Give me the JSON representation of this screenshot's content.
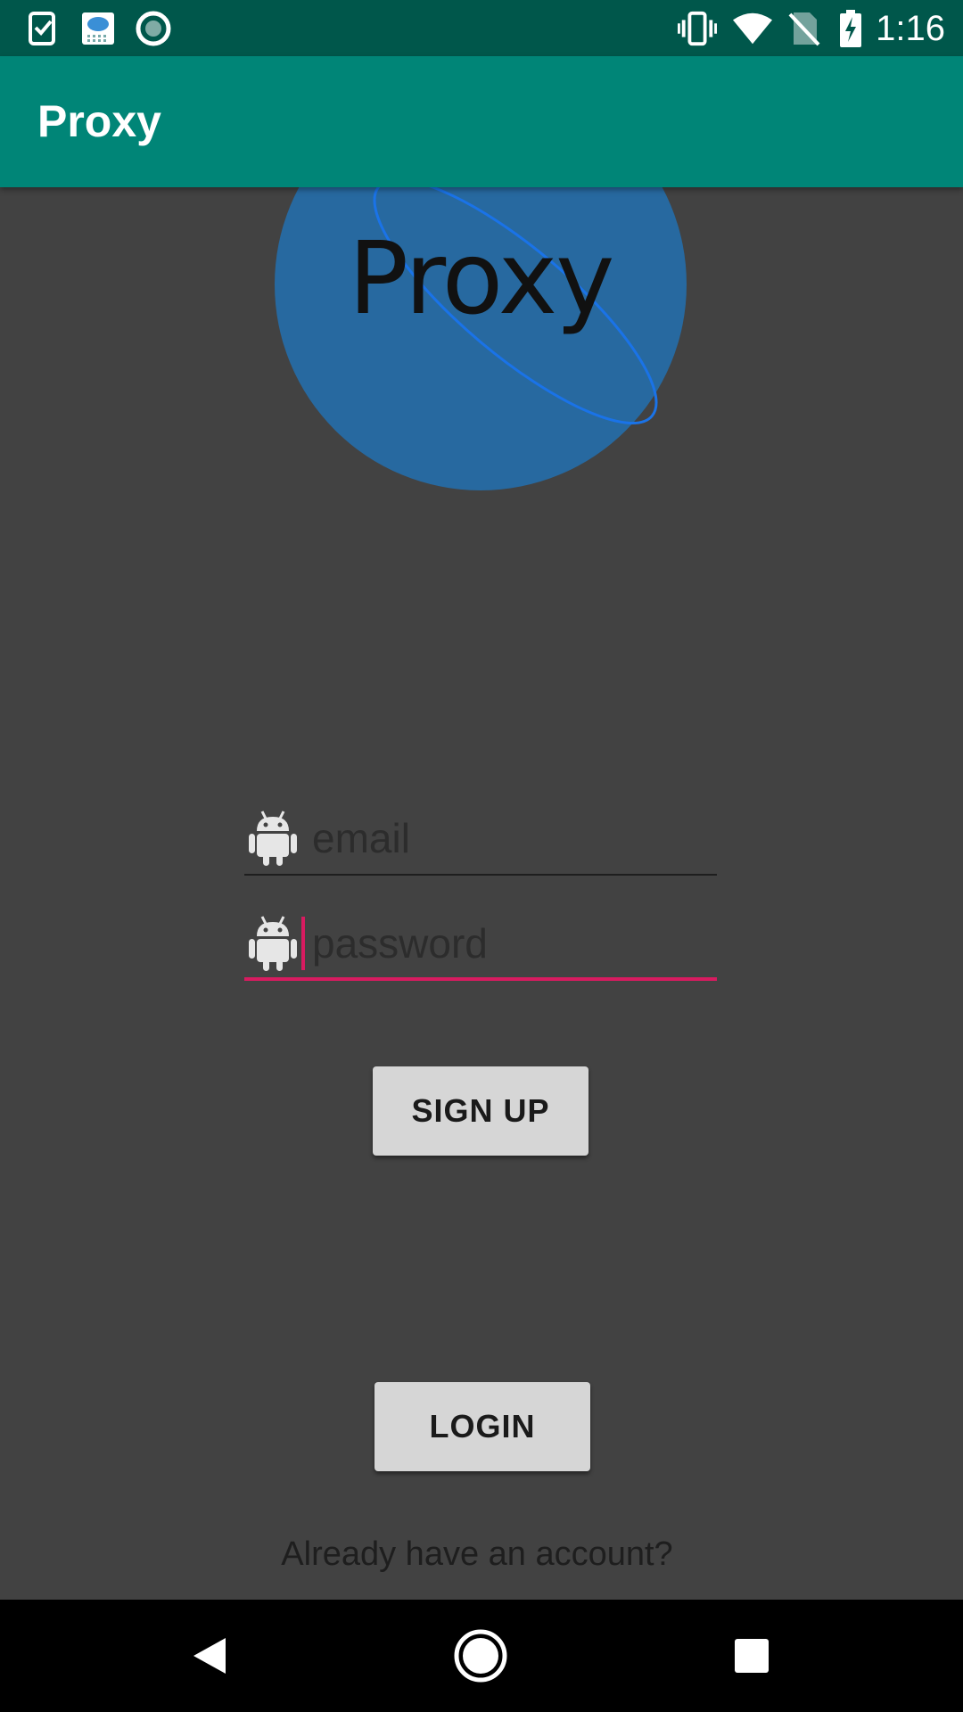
{
  "status_bar": {
    "time": "1:16",
    "left_icons": [
      "task-check-icon",
      "weather-app-icon",
      "record-circle-icon"
    ],
    "right_icons": [
      "vibrate-icon",
      "wifi-icon",
      "no-sim-icon",
      "battery-charging-icon"
    ]
  },
  "app_bar": {
    "title": "Proxy"
  },
  "logo": {
    "text": "Proxy",
    "color": "#2769a0"
  },
  "form": {
    "email": {
      "value": "",
      "placeholder": "email"
    },
    "password": {
      "value": "",
      "placeholder": "password"
    }
  },
  "buttons": {
    "signup_label": "SIGN UP",
    "login_label": "LOGIN"
  },
  "footer": {
    "already_text": "Already have an account?"
  },
  "nav_bar": {
    "icons": [
      "back-icon",
      "home-icon",
      "recents-icon"
    ]
  },
  "colors": {
    "status_bar": "#00574b",
    "app_bar": "#008577",
    "background": "#424242",
    "accent": "#d81b60"
  }
}
